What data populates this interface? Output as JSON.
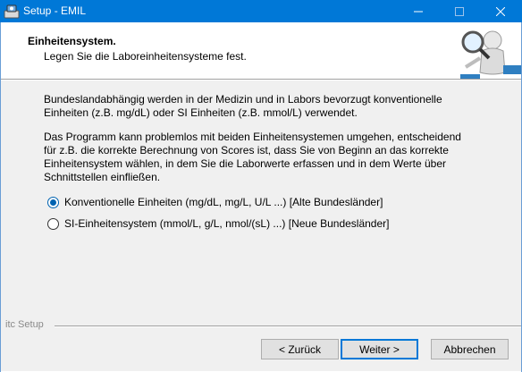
{
  "window": {
    "title": "Setup - EMIL",
    "accent": "#0078d7",
    "controls": [
      "minimize-icon",
      "maximize-icon",
      "close-icon"
    ]
  },
  "header": {
    "title": "Einheitensystem.",
    "subtitle": "Legen Sie die Laboreinheitensysteme fest."
  },
  "body": {
    "paragraph1": "Bundeslandabhängig werden in der Medizin und in Labors bevorzugt konventionelle Einheiten (z.B. mg/dL) oder SI Einheiten (z.B. mmol/L) verwendet.",
    "paragraph2": "Das Programm kann problemlos mit beiden Einheitensystemen umgehen, entscheidend für z.B. die korrekte Berechnung von Scores ist, dass Sie von Beginn an das korrekte Einheitensystem wählen, in dem Sie die Laborwerte erfassen und in dem Werte über Schnittstellen einfließen.",
    "options": [
      {
        "label": "Konventionelle Einheiten (mg/dL, mg/L, U/L ...) [Alte Bundesländer]",
        "selected": true
      },
      {
        "label": "SI-Einheitensystem (mmol/L, g/L, nmol/(sL) ...) [Neue Bundesländer]",
        "selected": false
      }
    ]
  },
  "footer": {
    "label": "itc Setup",
    "back_label": "< Zurück",
    "next_label": "Weiter >",
    "cancel_label": "Abbrechen"
  }
}
